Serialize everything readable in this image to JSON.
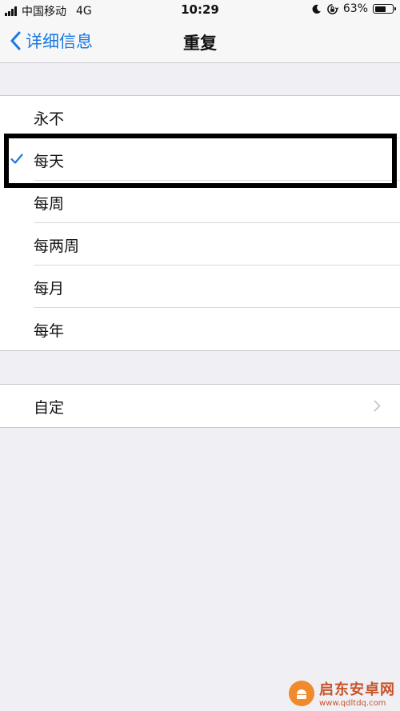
{
  "status_bar": {
    "carrier": "中国移动",
    "network": "4G",
    "time": "10:29",
    "battery_percent": "63%",
    "battery_level": 0.63
  },
  "nav": {
    "back_label": "详细信息",
    "title": "重复"
  },
  "repeat_options": [
    {
      "label": "永不",
      "selected": false
    },
    {
      "label": "每天",
      "selected": true
    },
    {
      "label": "每周",
      "selected": false
    },
    {
      "label": "每两周",
      "selected": false
    },
    {
      "label": "每月",
      "selected": false
    },
    {
      "label": "每年",
      "selected": false
    }
  ],
  "custom": {
    "label": "自定"
  },
  "watermark": {
    "name": "启东安卓网",
    "url": "www.qdltdq.com"
  },
  "colors": {
    "accent": "#1a7ae0",
    "background": "#efeff4",
    "highlight_border": "#000000"
  }
}
